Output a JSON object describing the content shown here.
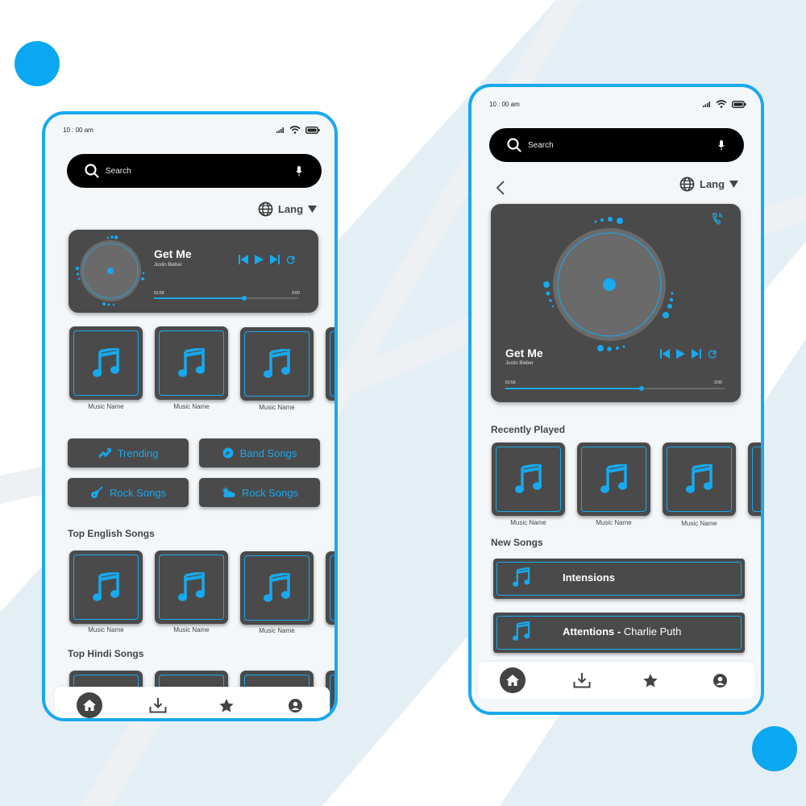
{
  "colors": {
    "accent": "#18a9ee",
    "card": "#4a4a4a",
    "search_bg": "#000000"
  },
  "left_screen": {
    "status_time": "10 : 00 am",
    "search_placeholder": "Search",
    "lang_label": "Lang",
    "now_playing": {
      "title": "Get Me",
      "artist": "Justin Bieber",
      "elapsed": "01:59",
      "duration": "3:00",
      "progress": 0.62
    },
    "featured_tiles": [
      "Music Name",
      "Music Name",
      "Music Name"
    ],
    "categories": [
      {
        "label": "Trending",
        "icon": "trending-icon"
      },
      {
        "label": "Band Songs",
        "icon": "disc-icon"
      },
      {
        "label": "Rock Songs",
        "icon": "guitar-icon"
      },
      {
        "label": "Rock Songs",
        "icon": "weather-icon"
      }
    ],
    "top_english_title": "Top English Songs",
    "top_english_tiles": [
      "Music Name",
      "Music Name",
      "Music Name"
    ],
    "top_hindi_title": "Top Hindi Songs",
    "nav": [
      "home-icon",
      "download-icon",
      "star-icon",
      "user-icon"
    ]
  },
  "right_screen": {
    "status_time": "10 : 00 am",
    "search_placeholder": "Search",
    "lang_label": "Lang",
    "now_playing": {
      "title": "Get Me",
      "artist": "Justin Bieber",
      "elapsed": "01:59",
      "duration": "3:00",
      "progress": 0.62
    },
    "recently_played_title": "Recently Played",
    "recently_played_tiles": [
      "Music Name",
      "Music Name",
      "Music Name"
    ],
    "new_songs_title": "New Songs",
    "new_songs": [
      {
        "title": "Intensions",
        "artist": ""
      },
      {
        "title": "Attentions - ",
        "artist": "Charlie Puth"
      }
    ],
    "nav": [
      "home-icon",
      "download-icon",
      "star-icon",
      "user-icon"
    ]
  }
}
